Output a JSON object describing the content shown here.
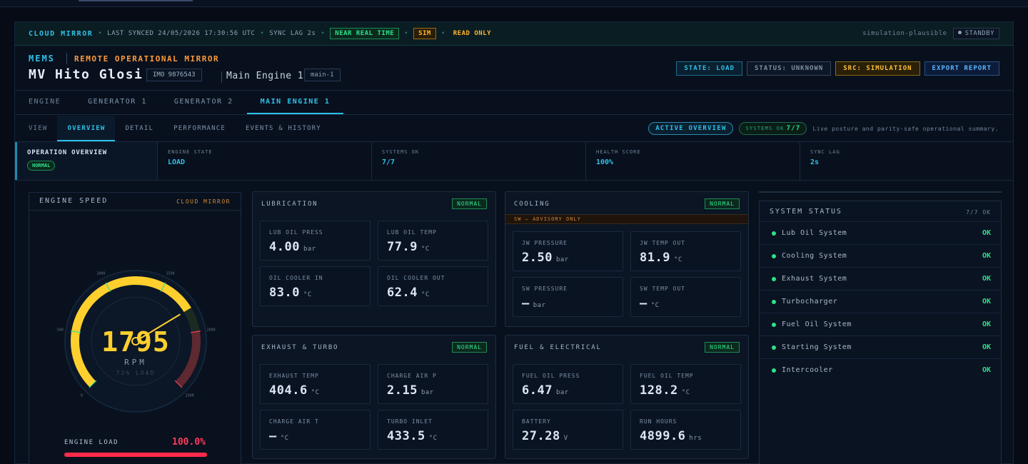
{
  "sync_bar": {
    "title": "CLOUD MIRROR",
    "last_synced": "LAST SYNCED 24/05/2026 17:30:56 UTC",
    "sync_lag": "SYNC LAG",
    "sync_lag_value": "2s",
    "near_real_time": "NEAR REAL TIME",
    "sim": "SIM",
    "read_only": "READ ONLY",
    "plausible": "simulation-plausible",
    "standby": "STANDBY"
  },
  "header": {
    "brand": "MEMS",
    "subtitle": "REMOTE OPERATIONAL MIRROR",
    "vessel": "MV Hito Glosi",
    "imo": "IMO 9876543",
    "engine_name": "Main Engine 1",
    "engine_id": "main-1",
    "buttons": {
      "state": "STATE: LOAD",
      "status": "STATUS: UNKNOWN",
      "source": "SRC: SIMULATION",
      "export": "EXPORT REPORT"
    }
  },
  "engine_tabs": {
    "label": "ENGINE",
    "items": [
      "GENERATOR 1",
      "GENERATOR 2",
      "MAIN ENGINE 1"
    ]
  },
  "view_tabs": {
    "label": "VIEW",
    "items": [
      "OVERVIEW",
      "DETAIL",
      "PERFORMANCE",
      "EVENTS & HISTORY"
    ],
    "active_overview": "ACTIVE OVERVIEW",
    "systems_ok_label": "SYSTEMS OK",
    "systems_ok_value": "7/7",
    "description": "Live posture and parity-safe operational summary."
  },
  "summary": {
    "title": "OPERATION OVERVIEW",
    "badge": "NORMAL",
    "cells": [
      {
        "label": "ENGINE STATE",
        "value": "LOAD"
      },
      {
        "label": "SYSTEMS OK",
        "value": "7/7"
      },
      {
        "label": "HEALTH SCORE",
        "value": "100%"
      },
      {
        "label": "SYNC LAG",
        "value": "2s"
      }
    ]
  },
  "gauge": {
    "title": "ENGINE SPEED",
    "badge": "CLOUD MIRROR",
    "rpm": "1795",
    "unit": "RPM",
    "load_text": "72% LOAD",
    "ticks": [
      "0",
      "500",
      "1000",
      "1500",
      "2000",
      "2500"
    ],
    "rpm_fraction": 0.718,
    "max_rpm": 2500,
    "engine_load_label": "ENGINE LOAD",
    "engine_load_value": "100.0%",
    "engine_load_fraction": 1.0,
    "colors": {
      "arc": "#ffcf2e",
      "redline": "#8a2a3a",
      "load_bar": "#ff2a4a"
    }
  },
  "cards": {
    "lubrication": {
      "title": "LUBRICATION",
      "badge": "NORMAL",
      "metrics": [
        {
          "label": "LUB OIL PRESS",
          "value": "4.00",
          "unit": "bar"
        },
        {
          "label": "LUB OIL TEMP",
          "value": "77.9",
          "unit": "°C"
        },
        {
          "label": "OIL COOLER IN",
          "value": "83.0",
          "unit": "°C"
        },
        {
          "label": "OIL COOLER OUT",
          "value": "62.4",
          "unit": "°C"
        }
      ]
    },
    "cooling": {
      "title": "COOLING",
      "badge": "NORMAL",
      "advisory": "SW — ADVISORY ONLY",
      "metrics": [
        {
          "label": "JW PRESSURE",
          "value": "2.50",
          "unit": "bar"
        },
        {
          "label": "JW TEMP OUT",
          "value": "81.9",
          "unit": "°C"
        },
        {
          "label": "SW PRESSURE",
          "value": "—",
          "unit": "bar"
        },
        {
          "label": "SW TEMP OUT",
          "value": "—",
          "unit": "°C"
        }
      ]
    },
    "exhaust": {
      "title": "EXHAUST & TURBO",
      "badge": "NORMAL",
      "metrics": [
        {
          "label": "EXHAUST TEMP",
          "value": "404.6",
          "unit": "°C"
        },
        {
          "label": "CHARGE AIR P",
          "value": "2.15",
          "unit": "bar"
        },
        {
          "label": "CHARGE AIR T",
          "value": "—",
          "unit": "°C"
        },
        {
          "label": "TURBO INLET",
          "value": "433.5",
          "unit": "°C"
        }
      ]
    },
    "fuel": {
      "title": "FUEL & ELECTRICAL",
      "badge": "NORMAL",
      "metrics": [
        {
          "label": "FUEL OIL PRESS",
          "value": "6.47",
          "unit": "bar"
        },
        {
          "label": "FUEL OIL TEMP",
          "value": "128.2",
          "unit": "°C"
        },
        {
          "label": "BATTERY",
          "value": "27.28",
          "unit": "V"
        },
        {
          "label": "RUN HOURS",
          "value": "4899.6",
          "unit": "hrs"
        }
      ]
    }
  },
  "system_status": {
    "title": "SYSTEM STATUS",
    "count": "7/7 OK",
    "items": [
      {
        "name": "Lub Oil System",
        "status": "OK"
      },
      {
        "name": "Cooling System",
        "status": "OK"
      },
      {
        "name": "Exhaust System",
        "status": "OK"
      },
      {
        "name": "Turbocharger",
        "status": "OK"
      },
      {
        "name": "Fuel Oil System",
        "status": "OK"
      },
      {
        "name": "Starting System",
        "status": "OK"
      },
      {
        "name": "Intercooler",
        "status": "OK"
      }
    ]
  }
}
